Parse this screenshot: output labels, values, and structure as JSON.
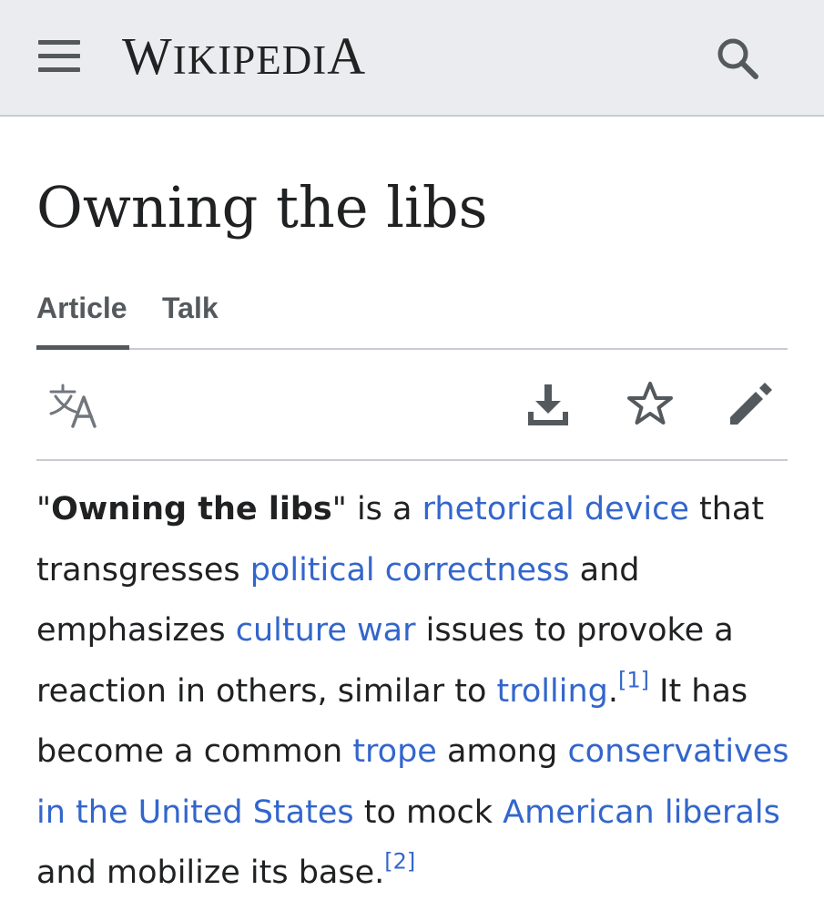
{
  "header": {
    "logo_first": "W",
    "logo_middle": "IKIPEDI",
    "logo_last": "A",
    "menu_icon": "hamburger-menu-icon",
    "search_icon": "search-icon"
  },
  "page": {
    "title": "Owning the libs"
  },
  "tabs": [
    {
      "label": "Article",
      "selected": true
    },
    {
      "label": "Talk",
      "selected": false
    }
  ],
  "toolbar": {
    "language_icon": "language-icon",
    "download_icon": "download-icon",
    "watch_icon": "star-icon",
    "edit_icon": "edit-pencil-icon"
  },
  "article": {
    "quote_open": "\"",
    "bold_term": "Owning the libs",
    "t1": "\" is a ",
    "link_rhetorical_device": "rhetorical device",
    "t2": " that transgresses ",
    "link_political_correctness": "political correctness",
    "t3": " and emphasizes ",
    "link_culture_war": "culture war",
    "t4": " issues to provoke a reaction in others, similar to ",
    "link_trolling": "trolling",
    "t5": ".",
    "ref1": "[1]",
    "t6": " It has become a common ",
    "link_trope": "trope",
    "t7": " among ",
    "link_conservatives_us": "conservatives in the United States",
    "t8": " to mock ",
    "link_american_liberals": "American liberals",
    "t9": " and mobilize its base.",
    "ref2": "[2]"
  },
  "colors": {
    "header_bg": "#eaecf0",
    "link": "#3366cc",
    "text": "#202122",
    "icon": "#54595d",
    "divider": "#c8ccd1"
  }
}
